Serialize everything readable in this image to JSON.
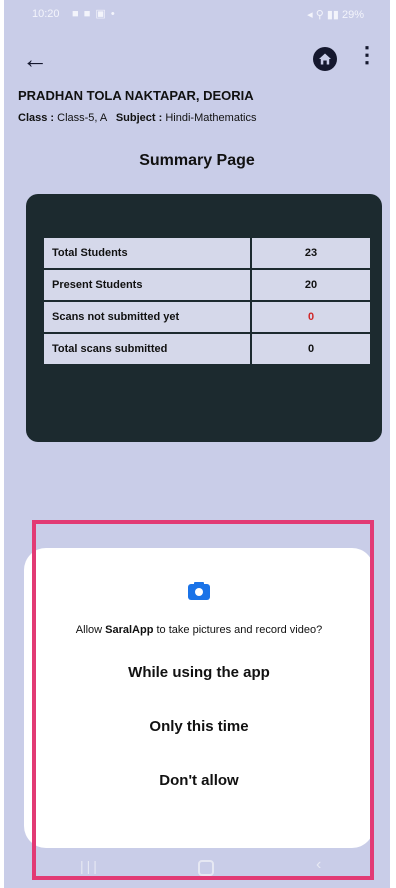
{
  "status_bar": {
    "time": "10:20",
    "left_icons": "■ ■ ▣ •",
    "right_icons": "◂ ⚲ ▮▮ 29%"
  },
  "app_bar": {
    "back_icon": "←",
    "home_icon": "home-icon",
    "more_icon": "⋮"
  },
  "header": {
    "school_name": "PRADHAN TOLA NAKTAPAR, DEORIA",
    "class_label": "Class :",
    "class_value": "Class-5, A",
    "subject_label": "Subject :",
    "subject_value": "Hindi-Mathematics"
  },
  "summary": {
    "title": "Summary Page",
    "rows": [
      {
        "label": "Total Students",
        "value": "23"
      },
      {
        "label": "Present Students",
        "value": "20"
      },
      {
        "label": "Scans not submitted yet",
        "value": "0"
      },
      {
        "label": "Total scans submitted",
        "value": "0"
      }
    ]
  },
  "permission_dialog": {
    "prompt_prefix": "Allow ",
    "app_name": "SaralApp",
    "prompt_suffix": " to take pictures and record video?",
    "option_while_using": "While using the app",
    "option_only_this_time": "Only this time",
    "option_dont_allow": "Don't allow"
  },
  "nav_bar": {
    "recents_icon": "|||",
    "back_icon": "‹"
  },
  "colors": {
    "screen_bg": "#c9cde8",
    "card_bg": "#1c2a2f",
    "alert_value": "#d0282a",
    "camera_icon": "#1a73e8",
    "highlight_border": "#e23a74"
  }
}
